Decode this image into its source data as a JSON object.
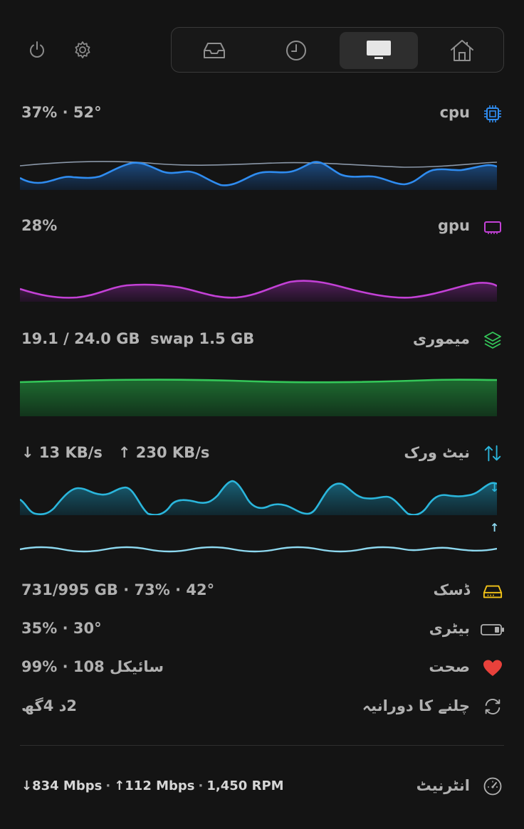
{
  "toolbar": {
    "power_icon": "power-icon",
    "settings_icon": "gear-icon",
    "tabs": [
      {
        "icon": "inbox-tray-icon",
        "active": false
      },
      {
        "icon": "clock-icon",
        "active": false
      },
      {
        "icon": "monitor-icon",
        "active": true
      },
      {
        "icon": "home-icon",
        "active": false
      }
    ]
  },
  "cpu": {
    "value": "37% · 52°",
    "label": "cpu",
    "color": "#2f8cf0"
  },
  "gpu": {
    "value": "28%",
    "label": "gpu",
    "color": "#c341d6"
  },
  "memory": {
    "value": "19.1 / 24.0 GB  swap 1.5 GB",
    "label": "میموری",
    "color": "#34c759"
  },
  "network": {
    "down_arrow": "↓",
    "down": "13 KB/s",
    "up_arrow": "↑",
    "up": "230 KB/s",
    "label": "نیٹ ورک",
    "down_color": "#2bb6dc",
    "up_color": "#8ed9f0",
    "graph_down_marker": "↓",
    "graph_up_marker": "↑"
  },
  "disk": {
    "value": "731/995 GB · 73% · 42°",
    "label": "ڈسک",
    "color": "#f5c518"
  },
  "battery": {
    "value": "35% · 30°",
    "label": "بیٹری"
  },
  "health": {
    "value": "99% · 108 سائیکل",
    "label": "صحت",
    "color": "#e8413b"
  },
  "uptime": {
    "value": "2د 4گھ",
    "label": "چلنے کا دورانیہ"
  },
  "internet": {
    "down_arrow": "↓",
    "down": "834 Mbps",
    "sep1": "·",
    "up_arrow": "↑",
    "up": "112 Mbps",
    "sep2": "·",
    "rpm": "1,450 RPM",
    "label": "انٹرنیٹ"
  }
}
